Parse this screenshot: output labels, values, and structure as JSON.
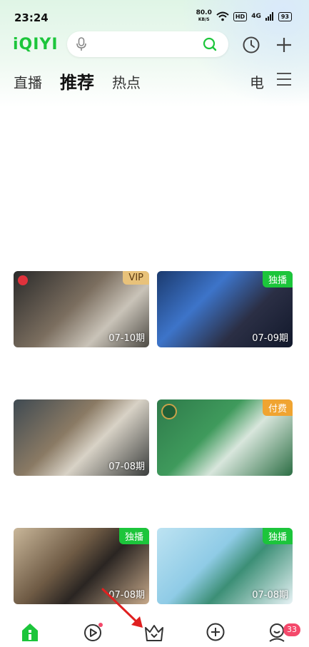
{
  "status_bar": {
    "time": "23:24",
    "net_speed": "80.0",
    "net_unit": "KB/S",
    "hd": "HD",
    "signal": "4G",
    "battery": "93"
  },
  "header": {
    "logo": "iQIYI",
    "icons": [
      "mic-icon",
      "search-icon",
      "history-icon",
      "plus-icon"
    ]
  },
  "tabs": {
    "items": [
      {
        "label": "直播"
      },
      {
        "label": "推荐"
      },
      {
        "label": "热点"
      }
    ],
    "active_index": 1,
    "right_label": "电"
  },
  "cards": [
    {
      "tag": "VIP",
      "tag_color": "#e8c27a",
      "episode": "07-10期"
    },
    {
      "tag": "独播",
      "tag_color": "#1cc53b",
      "episode": "07-09期"
    },
    {
      "tag": "",
      "tag_color": "",
      "episode": "07-08期"
    },
    {
      "tag": "付费",
      "tag_color": "#f0a431",
      "episode": ""
    },
    {
      "tag": "独播",
      "tag_color": "#1cc53b",
      "episode": "07-08期"
    },
    {
      "tag": "独播",
      "tag_color": "#1cc53b",
      "episode": "07-08期"
    }
  ],
  "bottom_nav": {
    "items": [
      "home-icon",
      "video-icon",
      "vip-crown-icon",
      "create-plus-icon",
      "profile-icon"
    ],
    "message_count": "33"
  },
  "colors": {
    "brand_green": "#1cc53b",
    "badge_red": "#f4496b",
    "arrow_red": "#e02020"
  }
}
